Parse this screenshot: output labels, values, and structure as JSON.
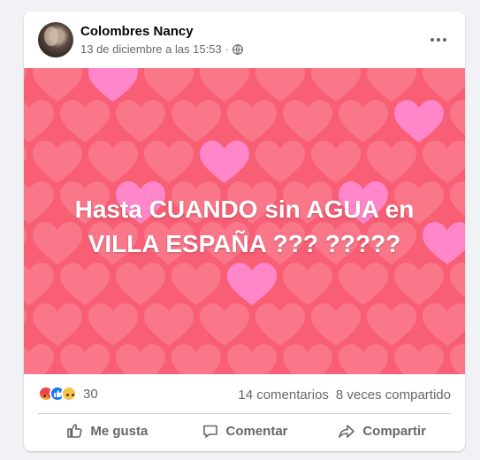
{
  "post": {
    "author": "Colombres Nancy",
    "timestamp": "13 de diciembre a las 15:53",
    "separator": "·",
    "privacy_icon": "globe-icon",
    "more_icon": "more-options-icon",
    "text_line1": "Hasta CUANDO sin AGUA en",
    "text_line2": "VILLA ESPAÑA ??? ?????",
    "background": {
      "base_color": "#f85f75",
      "heart_color": "#f98a99",
      "accent_heart_color": "#ff88cd"
    }
  },
  "stats": {
    "reactions": [
      "angry-reaction-icon",
      "like-reaction-icon",
      "sad-reaction-icon"
    ],
    "reaction_count": "30",
    "comments": "14 comentarios",
    "shares": "8 veces compartido"
  },
  "actions": {
    "like": "Me gusta",
    "comment": "Comentar",
    "share": "Compartir"
  },
  "colors": {
    "text_primary": "#050505",
    "text_secondary": "#65676b",
    "like_blue": "#1877f2"
  }
}
